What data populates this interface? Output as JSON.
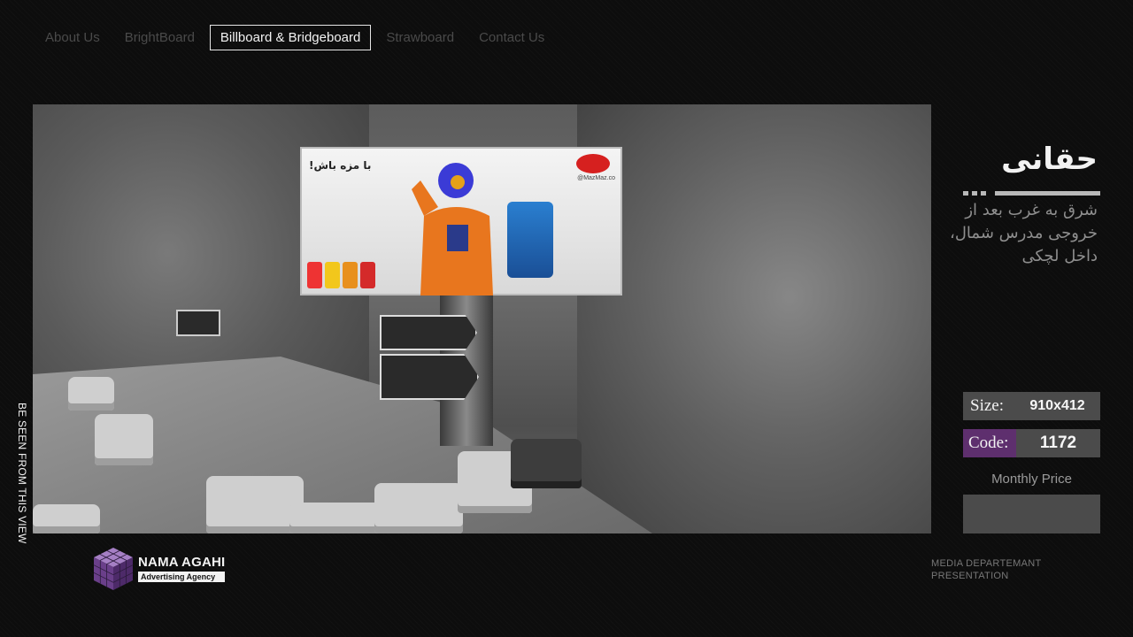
{
  "nav": {
    "items": [
      {
        "label": "About Us"
      },
      {
        "label": "BrightBoard"
      },
      {
        "label": "Billboard & Bridgeboard",
        "active": true
      },
      {
        "label": "Strawboard"
      },
      {
        "label": "Contact Us"
      }
    ]
  },
  "photo": {
    "billboard_tagline": "با مزه باش!",
    "billboard_site": "@MazMaz.co",
    "side_caption": "BE SEEN FROM THIS VIEW"
  },
  "location": {
    "title": "حقانی",
    "description": "شرق به غرب بعد از خروجی  مدرس شمال، داخل لچکی"
  },
  "details": {
    "size_label": "Size:",
    "size_value": "910x412",
    "code_label": "Code:",
    "code_value": "1172",
    "price_label": "Monthly Price",
    "price_value": ""
  },
  "brand": {
    "name": "NAMA AGAHI",
    "subtitle": "Advertising Agency",
    "footer_line1": "MEDIA DEPARTEMANT",
    "footer_line2": "PRESENTATION"
  },
  "colors": {
    "accent_purple": "#5e2f6e",
    "panel_gray": "#4b4b4b",
    "nav_inactive": "#4a4a4a",
    "nav_active": "#f2f2f2"
  }
}
